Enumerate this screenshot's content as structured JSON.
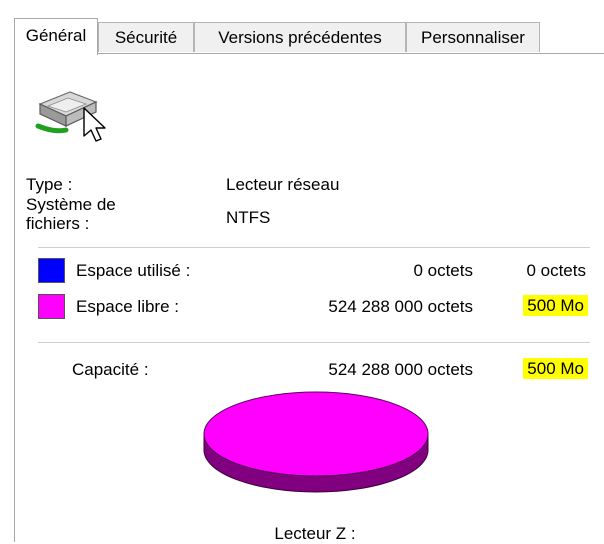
{
  "tabs": [
    {
      "label": "Général",
      "active": true
    },
    {
      "label": "Sécurité",
      "active": false
    },
    {
      "label": "Versions précédentes",
      "active": false
    },
    {
      "label": "Personnaliser",
      "active": false
    }
  ],
  "drive_icon": "network-drive-icon",
  "properties": {
    "type_label": "Type :",
    "type_value": "Lecteur réseau",
    "fs_label_line1": "Système de",
    "fs_label_line2": "fichiers :",
    "fs_value": "NTFS"
  },
  "space": {
    "used": {
      "label": "Espace utilisé :",
      "bytes": "0 octets",
      "human": "0 octets",
      "color": "#0000ff"
    },
    "free": {
      "label": "Espace libre :",
      "bytes": "524 288 000 octets",
      "human": "500 Mo",
      "color": "#ff00ff"
    },
    "capacity": {
      "label": "Capacité :",
      "bytes": "524 288 000 octets",
      "human": "500 Mo"
    }
  },
  "chart_data": {
    "type": "pie",
    "categories": [
      "Espace utilisé",
      "Espace libre"
    ],
    "values": [
      0,
      524288000
    ],
    "colors": [
      "#0000ff",
      "#ff00ff"
    ]
  },
  "drive_label": "Lecteur Z :",
  "highlight_color": "#ffff00"
}
